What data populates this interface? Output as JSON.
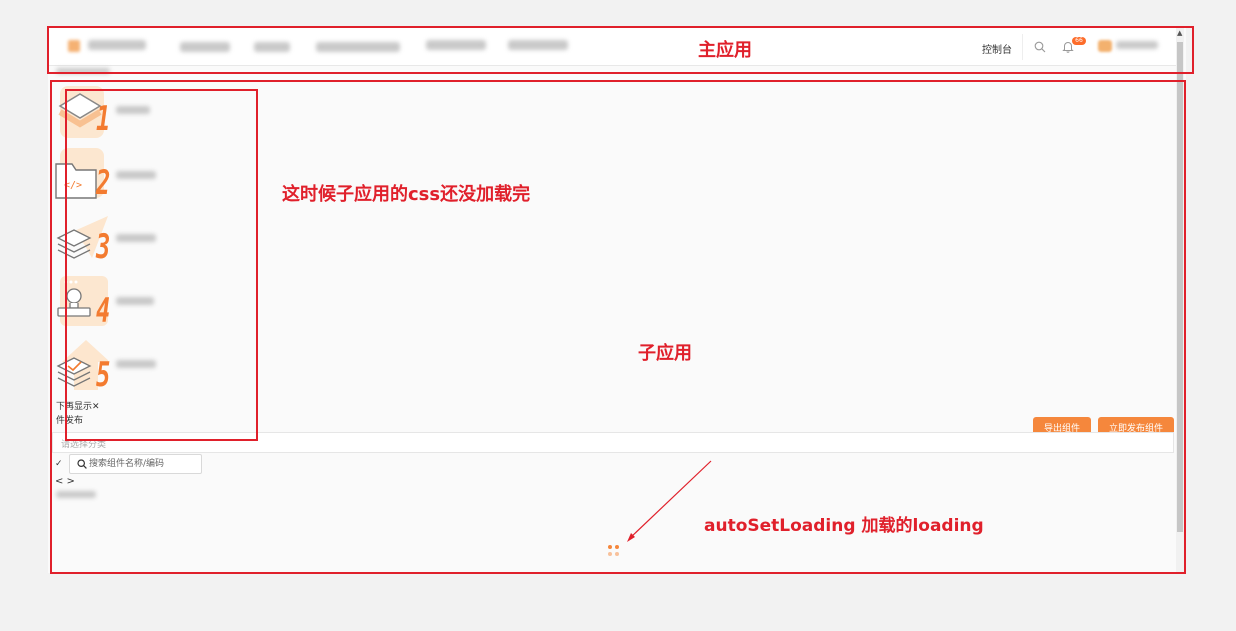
{
  "header": {
    "control_panel": "控制台",
    "notification_count": "66"
  },
  "sidebar": {
    "step_numbers": [
      "1",
      "2",
      "3",
      "4",
      "5"
    ],
    "dont_show_again": "下再显示",
    "close_symbol": "✕",
    "component_publish": "件发布"
  },
  "toolbar": {
    "export_button": "导出组件",
    "publish_button": "立即发布组件"
  },
  "filter": {
    "category_placeholder": "请选择分类",
    "search_placeholder": "搜索组件名称/编码",
    "check_symbol": "✓",
    "code_symbol": "< >"
  },
  "annotations": {
    "main_app": "主应用",
    "css_not_loaded": "这时候子应用的css还没加载完",
    "sub_app": "子应用",
    "auto_loading": "autoSetLoading  加载的loading"
  },
  "colors": {
    "annotation": "#e0202b",
    "accent": "#f5873c",
    "badge": "#fd6c2a"
  }
}
